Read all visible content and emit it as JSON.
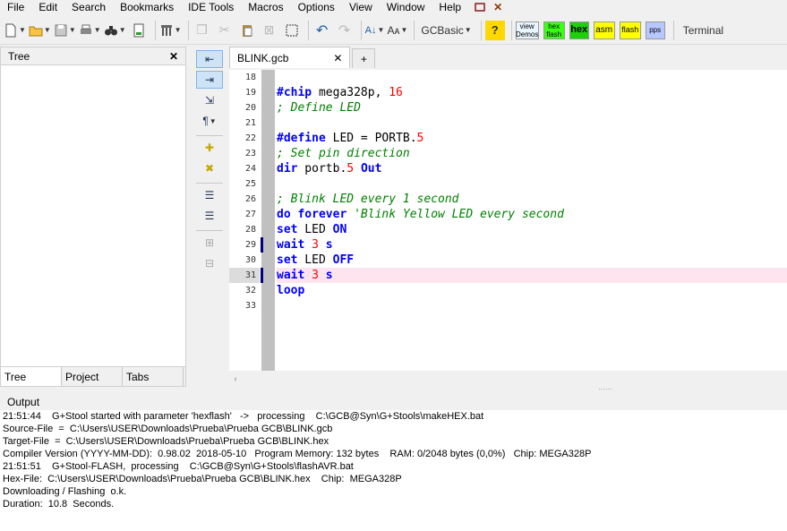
{
  "menu": [
    "File",
    "Edit",
    "Search",
    "Bookmarks",
    "IDE Tools",
    "Macros",
    "Options",
    "View",
    "Window",
    "Help"
  ],
  "menu_icons": [
    "window-restore-icon",
    "close-tools-icon"
  ],
  "toolbar": {
    "gcbasic_label": "GCBasic",
    "view_demos": "view Demos",
    "hex_flash": "hex flash",
    "hex": "hex",
    "asm": "asm",
    "flash": "flash",
    "pps": "pps",
    "terminal": "Terminal",
    "colors": {
      "hexflash_bg": "#39ff14",
      "hex_bg": "#1ed00c",
      "asm_bg": "#ffff00",
      "flash_bg": "#ffff00",
      "pps_bg": "#b7c7ff",
      "view_demos_bg": "#e8f6ff"
    }
  },
  "tree": {
    "title": "Tree",
    "tabs": [
      "Tree",
      "Project",
      "Tabs"
    ]
  },
  "editor": {
    "file_tab": "BLINK.gcb",
    "current_line": 31,
    "lines": [
      {
        "n": 18,
        "tokens": []
      },
      {
        "n": 19,
        "tokens": [
          {
            "t": "kw",
            "v": "#chip"
          },
          {
            "t": "id",
            "v": " mega328p, "
          },
          {
            "t": "num",
            "v": "16"
          }
        ]
      },
      {
        "n": 20,
        "tokens": [
          {
            "t": "cm",
            "v": "; Define LED"
          }
        ]
      },
      {
        "n": 21,
        "tokens": []
      },
      {
        "n": 22,
        "tokens": [
          {
            "t": "kw",
            "v": "#define"
          },
          {
            "t": "id",
            "v": " LED = PORTB."
          },
          {
            "t": "num",
            "v": "5"
          }
        ]
      },
      {
        "n": 23,
        "tokens": [
          {
            "t": "cm",
            "v": "; Set pin direction"
          }
        ]
      },
      {
        "n": 24,
        "tokens": [
          {
            "t": "kw",
            "v": "dir"
          },
          {
            "t": "id",
            "v": " portb."
          },
          {
            "t": "num",
            "v": "5"
          },
          {
            "t": "id",
            "v": " "
          },
          {
            "t": "kw",
            "v": "Out"
          }
        ]
      },
      {
        "n": 25,
        "tokens": []
      },
      {
        "n": 26,
        "tokens": [
          {
            "t": "cm",
            "v": "; Blink LED every 1 second"
          }
        ]
      },
      {
        "n": 27,
        "tokens": [
          {
            "t": "kw",
            "v": "do forever"
          },
          {
            "t": "id",
            "v": " "
          },
          {
            "t": "cm",
            "v": "'Blink Yellow LED every second"
          }
        ]
      },
      {
        "n": 28,
        "tokens": [
          {
            "t": "kw",
            "v": "set"
          },
          {
            "t": "id",
            "v": " LED "
          },
          {
            "t": "kw",
            "v": "ON"
          }
        ]
      },
      {
        "n": 29,
        "tokens": [
          {
            "t": "kw",
            "v": "wait"
          },
          {
            "t": "id",
            "v": " "
          },
          {
            "t": "num",
            "v": "3"
          },
          {
            "t": "id",
            "v": " "
          },
          {
            "t": "kw",
            "v": "s"
          }
        ]
      },
      {
        "n": 30,
        "tokens": [
          {
            "t": "kw",
            "v": "set"
          },
          {
            "t": "id",
            "v": " LED "
          },
          {
            "t": "kw",
            "v": "OFF"
          }
        ]
      },
      {
        "n": 31,
        "tokens": [
          {
            "t": "kw",
            "v": "wait"
          },
          {
            "t": "id",
            "v": " "
          },
          {
            "t": "num",
            "v": "3"
          },
          {
            "t": "id",
            "v": " "
          },
          {
            "t": "kw",
            "v": "s"
          }
        ]
      },
      {
        "n": 32,
        "tokens": [
          {
            "t": "kw",
            "v": "loop"
          }
        ]
      },
      {
        "n": 33,
        "tokens": []
      }
    ],
    "changed_lines": [
      29,
      31
    ],
    "colors": {
      "keyword": "#0000ff",
      "number": "#ff0000",
      "comment": "#008000",
      "current_line_bg": "#fde4ee"
    }
  },
  "output": {
    "title": "Output",
    "lines": [
      "21:51:44    G+Stool started with parameter 'hexflash'   ->   processing    C:\\GCB@Syn\\G+Stools\\makeHEX.bat",
      "Source-File  =  C:\\Users\\USER\\Downloads\\Prueba\\Prueba GCB\\BLINK.gcb",
      "Target-File  =  C:\\Users\\USER\\Downloads\\Prueba\\Prueba GCB\\BLINK.hex",
      "Compiler Version (YYYY-MM-DD):  0.98.02  2018-05-10   Program Memory: 132 bytes    RAM: 0/2048 bytes (0,0%)   Chip: MEGA328P",
      "21:51:51    G+Stool-FLASH,  processing    C:\\GCB@Syn\\G+Stools\\flashAVR.bat",
      "Hex-File:  C:\\Users\\USER\\Downloads\\Prueba\\Prueba GCB\\BLINK.hex    Chip:  MEGA328P",
      "Downloading / Flashing  o.k.",
      "Duration:  10.8  Seconds."
    ]
  }
}
